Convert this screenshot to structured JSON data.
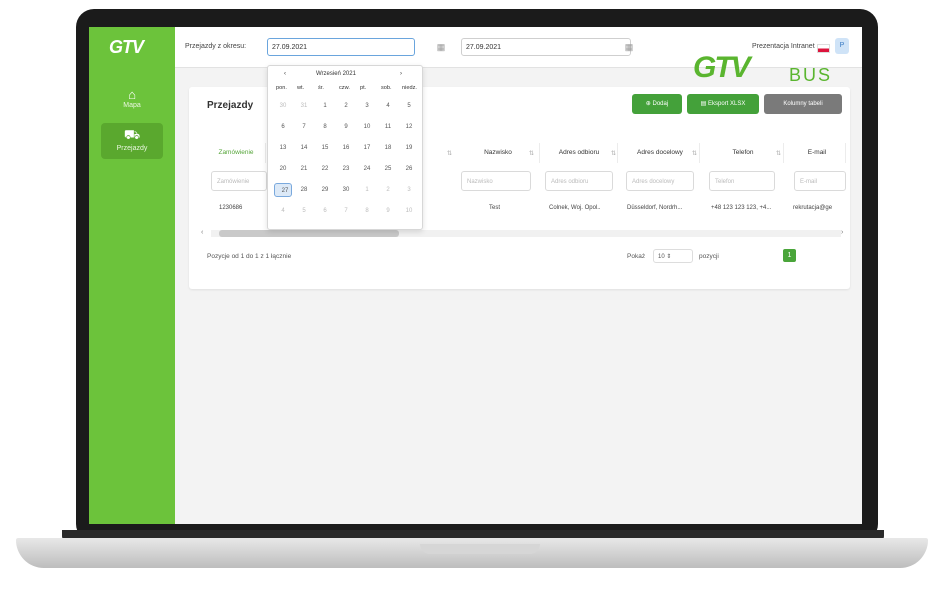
{
  "app": {
    "logo": "GTV",
    "brand": {
      "logo": "GTV",
      "bus": "BUS"
    }
  },
  "sidebar": {
    "items": [
      {
        "label": "Mapa",
        "icon": "home-icon"
      },
      {
        "label": "Przejazdy",
        "icon": "bus-icon"
      }
    ]
  },
  "topbar": {
    "range_label": "Przejazdy z okresu:",
    "date_from": "27.09.2021",
    "date_to": "27.09.2021",
    "user": "Prezentacja Intranet",
    "avatar": "P"
  },
  "datepicker": {
    "month": "Wrzesień 2021",
    "prev": "‹",
    "next": "›",
    "weekdays": [
      "pon.",
      "wt.",
      "śr.",
      "czw.",
      "pt.",
      "sob.",
      "niedz."
    ],
    "weeks": [
      [
        "30",
        "31",
        "1",
        "2",
        "3",
        "4",
        "5"
      ],
      [
        "6",
        "7",
        "8",
        "9",
        "10",
        "11",
        "12"
      ],
      [
        "13",
        "14",
        "15",
        "16",
        "17",
        "18",
        "19"
      ],
      [
        "20",
        "21",
        "22",
        "23",
        "24",
        "25",
        "26"
      ],
      [
        "27",
        "28",
        "29",
        "30",
        "1",
        "2",
        "3"
      ],
      [
        "4",
        "5",
        "6",
        "7",
        "8",
        "9",
        "10"
      ]
    ],
    "selected": "27"
  },
  "card": {
    "title": "Przejazdy",
    "buttons": {
      "add": "Dodaj",
      "export": "Eksport XLSX",
      "columns": "Kolumny tabeli"
    }
  },
  "table": {
    "headers": [
      {
        "label": "Zamówienie"
      },
      {
        "label": "Nazwisko"
      },
      {
        "label": "Adres odbioru"
      },
      {
        "label": "Adres docelowy"
      },
      {
        "label": "Telefon"
      },
      {
        "label": "E-mail"
      }
    ],
    "filters": [
      "Zamówienie",
      "Nazwisko",
      "Adres odbioru",
      "Adres docelowy",
      "Telefon",
      "E-mail"
    ],
    "rows": [
      {
        "order": "1230686",
        "surname": "Test",
        "pickup": "Colnek, Woj. Opol..",
        "dest": "Düsseldorf, Nordrh...",
        "phone": "+48 123 123 123, +4...",
        "email": "rekrutacja@ge"
      }
    ]
  },
  "footer": {
    "info": "Pozycje od 1 do 1 z 1 łącznie",
    "show": "Pokaż",
    "per_page": "10",
    "positions": "pozycji",
    "page": "1"
  }
}
